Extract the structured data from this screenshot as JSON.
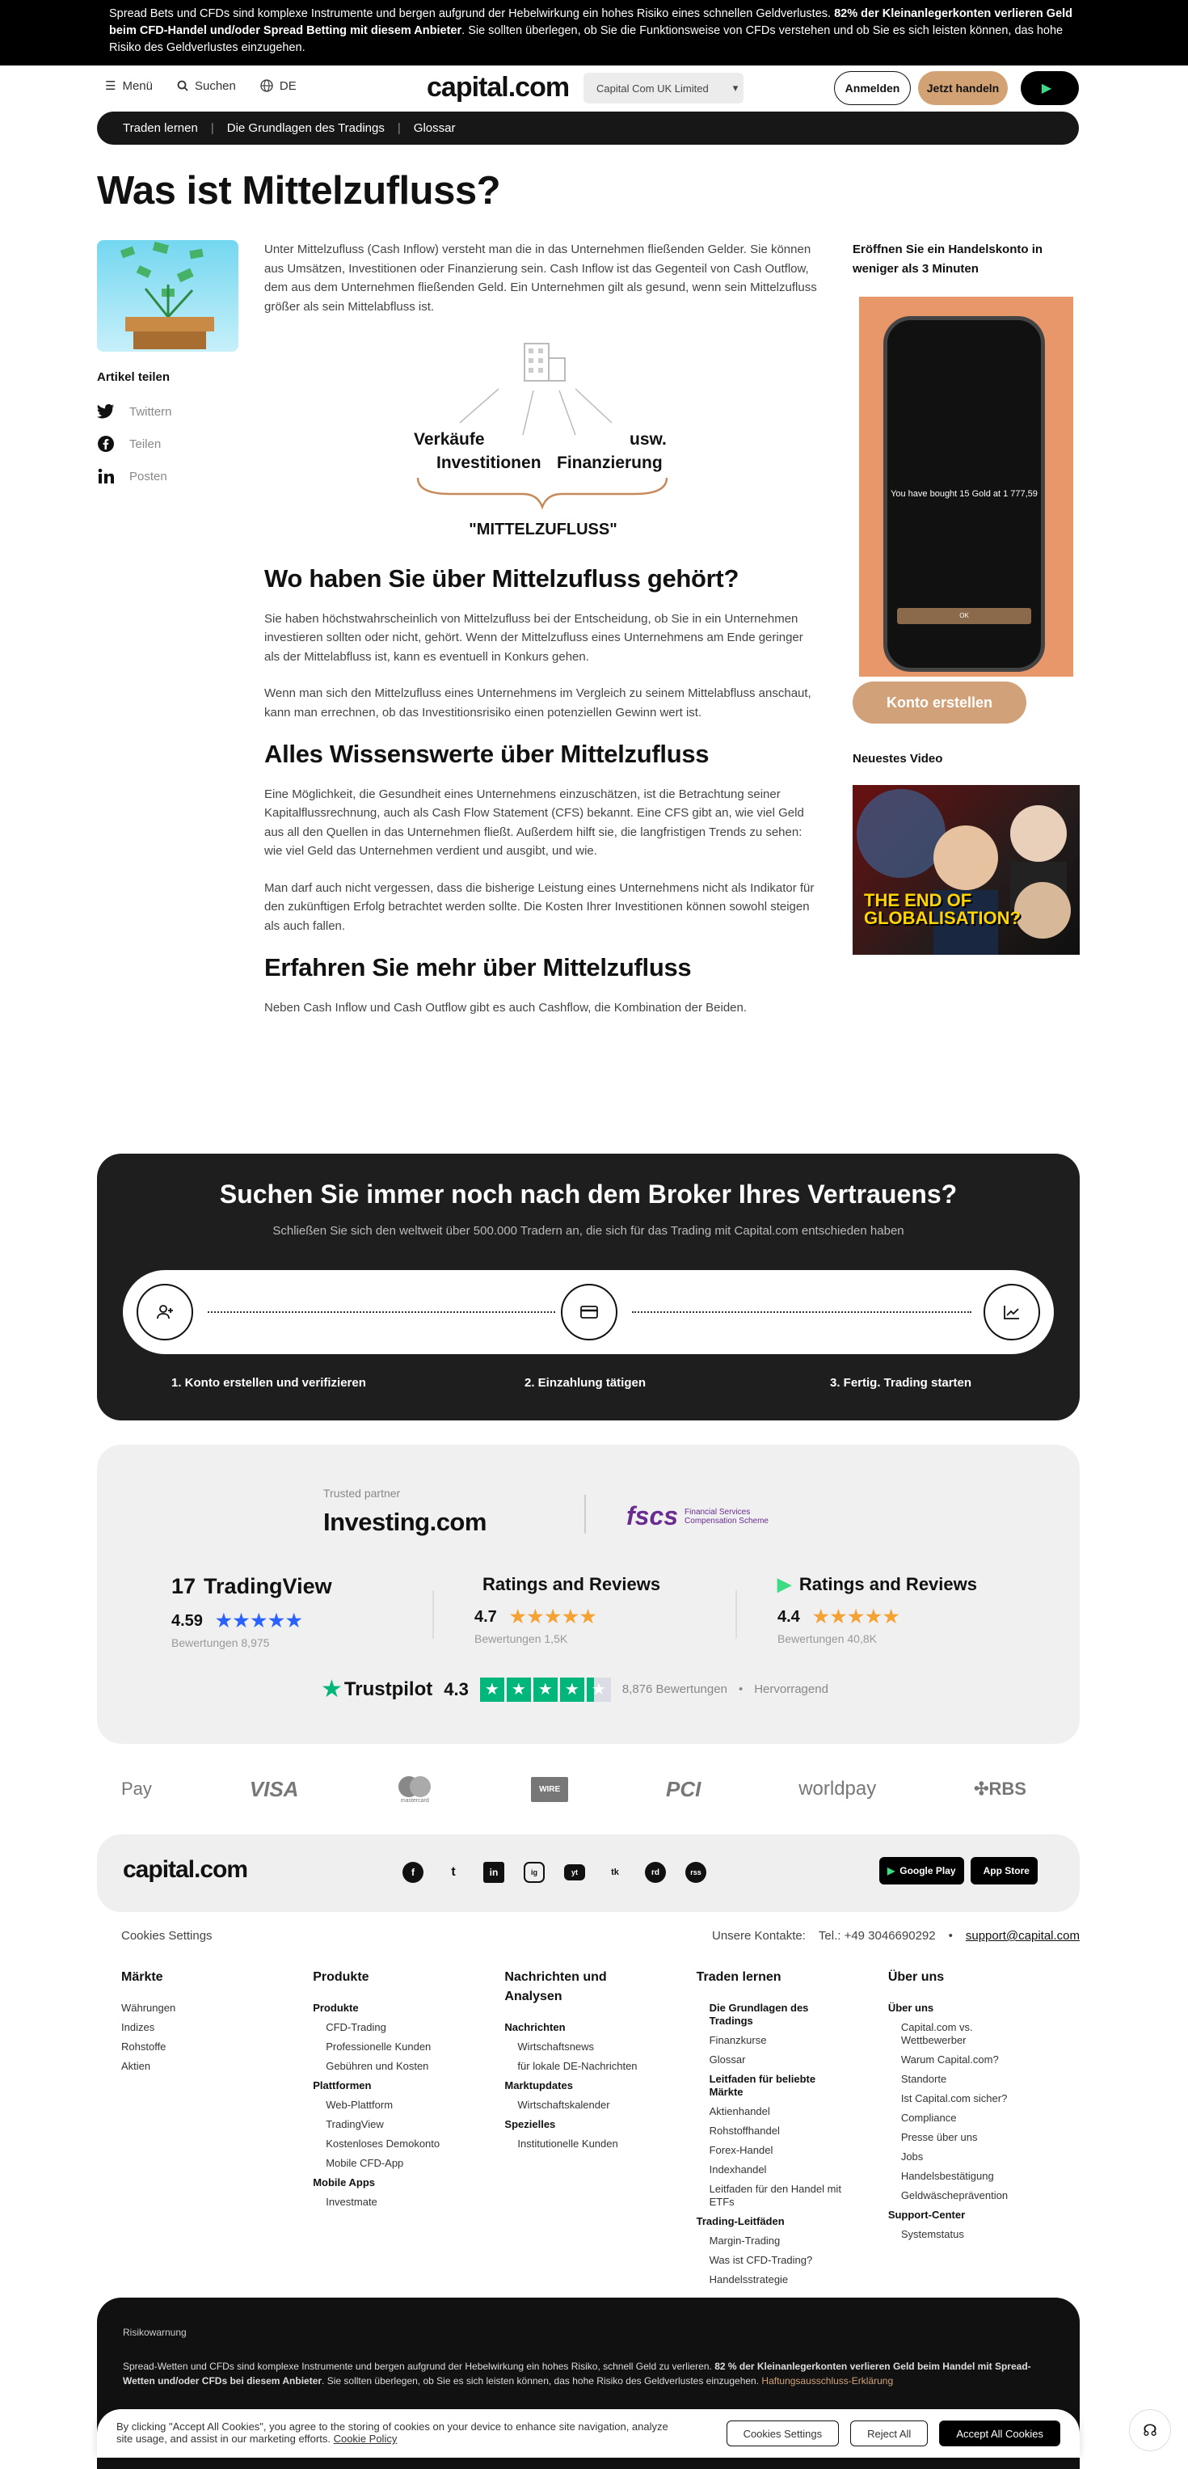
{
  "banner": {
    "text_1": "Spread Bets und CFDs sind komplexe Instrumente und bergen aufgrund der Hebelwirkung ein hohes Risiko eines schnellen Geldverlustes.",
    "bold": "82% der Kleinanlegerkonten verlieren Geld beim CFD-Handel und/oder Spread Betting mit diesem Anbieter",
    "text_2": ". Sie sollten überlegen, ob Sie die Funktionsweise von CFDs verstehen und ob Sie es sich leisten können, das hohe Risiko des Geldverlustes einzugehen."
  },
  "header": {
    "menu": "Menü",
    "search": "Suchen",
    "lang": "DE",
    "logo": "capital.com",
    "entity": "Capital Com UK Limited",
    "login": "Anmelden",
    "trade": "Jetzt handeln"
  },
  "breadcrumb": [
    "Traden lernen",
    "Die Grundlagen des Tradings",
    "Glossar"
  ],
  "page_title": "Was ist Mittelzufluss?",
  "share": {
    "title": "Artikel teilen",
    "items": [
      "Twittern",
      "Teilen",
      "Posten"
    ]
  },
  "article": {
    "intro": "Unter Mittelzufluss (Cash Inflow) versteht man die in das Unternehmen fließenden Gelder. Sie können aus Umsätzen, Investitionen oder Finanzierung sein. Cash Inflow ist das Gegenteil von Cash Outflow, dem aus dem Unternehmen fließenden Geld. Ein Unternehmen gilt als gesund, wenn sein Mittelzufluss größer als sein Mittelabfluss ist.",
    "diagram": {
      "sales": "Verkäufe",
      "investments": "Investitionen",
      "financing": "Finanzierung",
      "etc": "usw.",
      "label": "\"MITTELZUFLUSS\""
    },
    "h2_1": "Wo haben Sie über Mittelzufluss gehört?",
    "p1": "Sie haben höchstwahrscheinlich von Mittelzufluss bei der Entscheidung, ob Sie in ein Unternehmen investieren sollten oder nicht, gehört. Wenn der Mittelzufluss eines Unternehmens am Ende geringer als der Mittelabfluss ist, kann es eventuell in Konkurs gehen.",
    "p2": "Wenn man sich den Mittelzufluss eines Unternehmens im Vergleich zu seinem Mittelabfluss anschaut, kann man errechnen, ob das Investitionsrisiko einen potenziellen Gewinn wert ist.",
    "h2_2": "Alles Wissenswerte über Mittelzufluss",
    "p3": "Eine Möglichkeit, die Gesundheit eines Unternehmens einzuschätzen, ist die Betrachtung seiner Kapitalflussrechnung, auch als Cash Flow Statement (CFS) bekannt. Eine CFS gibt an, wie viel Geld aus all den Quellen in das Unternehmen fließt. Außerdem hilft sie, die langfristigen Trends zu sehen: wie viel Geld das Unternehmen verdient und ausgibt, und wie.",
    "p4": "Man darf auch nicht vergessen, dass die bisherige Leistung eines Unternehmens nicht als Indikator für den zukünftigen Erfolg betrachtet werden sollte. Die Kosten Ihrer Investitionen können sowohl steigen als auch fallen.",
    "h2_3": "Erfahren Sie mehr über Mittelzufluss",
    "p5": "Neben Cash Inflow und Cash Outflow gibt es auch Cashflow, die Kombination der Beiden."
  },
  "sidebar": {
    "title": "Eröffnen Sie ein Handelskonto in weniger als 3 Minuten",
    "phone_msg": "You have bought 15 Gold at 1 777,59",
    "phone_ok": "OK",
    "button": "Konto erstellen",
    "video_title": "Neuestes Video",
    "video_text": "THE END OF GLOBALISATION?"
  },
  "cta": {
    "title": "Suchen Sie immer noch nach dem Broker Ihres Vertrauens?",
    "subtitle": "Schließen Sie sich den weltweit über 500.000 Tradern an, die sich für das Trading mit Capital.com entschieden haben",
    "steps": [
      "1. Konto erstellen und verifizieren",
      "2. Einzahlung tätigen",
      "3. Fertig. Trading starten"
    ]
  },
  "trust": {
    "trusted_partner": "Trusted partner",
    "investing": "Investing.com",
    "fscs": "fscs",
    "fscs_sub": "Financial Services Compensation Scheme",
    "ratings": [
      {
        "brand": "TradingView",
        "score": "4.59",
        "stars": 4.59,
        "count": "Bewertungen 8,975"
      },
      {
        "brand": "Ratings and Reviews",
        "score": "4.7",
        "stars": 4.7,
        "count": "Bewertungen 1,5K"
      },
      {
        "brand": "Ratings and Reviews",
        "score": "4.4",
        "stars": 4.4,
        "count": "Bewertungen 40,8K"
      }
    ],
    "trustpilot": "Trustpilot",
    "tp_score": "4.3",
    "tp_count": "8,876 Bewertungen",
    "tp_label": "Hervorragend"
  },
  "payments": [
    "Pay",
    "VISA",
    "mastercard",
    "WIRE",
    "PCI",
    "worldpay",
    "RBS"
  ],
  "footer": {
    "logo": "capital.com",
    "socials": [
      "f",
      "t",
      "in",
      "ig",
      "yt",
      "tk",
      "rd",
      "rss"
    ],
    "stores": [
      "Google Play",
      "App Store"
    ],
    "cookies": "Cookies Settings",
    "contacts_label": "Unsere Kontakte:",
    "phone": "Tel.: +49 3046690292",
    "email": "support@capital.com",
    "cols": [
      {
        "title": "Märkte",
        "items": [
          {
            "t": "Währungen",
            "g": 0,
            "i": 0
          },
          {
            "t": "Indizes",
            "g": 0,
            "i": 0
          },
          {
            "t": "Rohstoffe",
            "g": 0,
            "i": 0
          },
          {
            "t": "Aktien",
            "g": 0,
            "i": 0
          }
        ]
      },
      {
        "title": "Produkte",
        "items": [
          {
            "t": "Produkte",
            "g": 1,
            "i": 0
          },
          {
            "t": "CFD-Trading",
            "g": 0,
            "i": 1
          },
          {
            "t": "Professionelle Kunden",
            "g": 0,
            "i": 1
          },
          {
            "t": "Gebühren und Kosten",
            "g": 0,
            "i": 1
          },
          {
            "t": "Plattformen",
            "g": 1,
            "i": 0
          },
          {
            "t": "Web-Plattform",
            "g": 0,
            "i": 1
          },
          {
            "t": "TradingView",
            "g": 0,
            "i": 1
          },
          {
            "t": "Kostenloses Demokonto",
            "g": 0,
            "i": 1
          },
          {
            "t": "Mobile CFD-App",
            "g": 0,
            "i": 1
          },
          {
            "t": "Mobile Apps",
            "g": 1,
            "i": 0
          },
          {
            "t": "Investmate",
            "g": 0,
            "i": 1
          }
        ]
      },
      {
        "title": "Nachrichten und Analysen",
        "items": [
          {
            "t": "Nachrichten",
            "g": 1,
            "i": 0
          },
          {
            "t": "Wirtschaftsnews",
            "g": 0,
            "i": 1
          },
          {
            "t": "für lokale DE-Nachrichten",
            "g": 0,
            "i": 1
          },
          {
            "t": "Marktupdates",
            "g": 1,
            "i": 0
          },
          {
            "t": "Wirtschaftskalender",
            "g": 0,
            "i": 1
          },
          {
            "t": "Spezielles",
            "g": 1,
            "i": 0
          },
          {
            "t": "Institutionelle Kunden",
            "g": 0,
            "i": 1
          }
        ]
      },
      {
        "title": "Traden lernen",
        "items": [
          {
            "t": "Die Grundlagen des Tradings",
            "g": 1,
            "i": 0
          },
          {
            "t": "Finanzkurse",
            "g": 0,
            "i": 1
          },
          {
            "t": "Glossar",
            "g": 0,
            "i": 1
          },
          {
            "t": "Leitfaden für beliebte Märkte",
            "g": 1,
            "i": 0
          },
          {
            "t": "Aktienhandel",
            "g": 0,
            "i": 1
          },
          {
            "t": "Rohstoffhandel",
            "g": 0,
            "i": 1
          },
          {
            "t": "Forex-Handel",
            "g": 0,
            "i": 1
          },
          {
            "t": "Indexhandel",
            "g": 0,
            "i": 1
          },
          {
            "t": "Leitfaden für den Handel mit ETFs",
            "g": 0,
            "i": 1
          },
          {
            "t": "Trading-Leitfäden",
            "g": 1,
            "i": 0
          },
          {
            "t": "Margin-Trading",
            "g": 0,
            "i": 1
          },
          {
            "t": "Was ist CFD-Trading?",
            "g": 0,
            "i": 1
          },
          {
            "t": "Handelsstrategie",
            "g": 0,
            "i": 1
          }
        ]
      },
      {
        "title": "Über uns",
        "items": [
          {
            "t": "Über uns",
            "g": 1,
            "i": 0
          },
          {
            "t": "Capital.com vs. Wettbewerber",
            "g": 0,
            "i": 1
          },
          {
            "t": "Warum Capital.com?",
            "g": 0,
            "i": 1
          },
          {
            "t": "Standorte",
            "g": 0,
            "i": 1
          },
          {
            "t": "Ist Capital.com sicher?",
            "g": 0,
            "i": 1
          },
          {
            "t": "Compliance",
            "g": 0,
            "i": 1
          },
          {
            "t": "Presse über uns",
            "g": 0,
            "i": 1
          },
          {
            "t": "Jobs",
            "g": 0,
            "i": 1
          },
          {
            "t": "Handelsbestätigung",
            "g": 0,
            "i": 1
          },
          {
            "t": "Geldwäscheprävention",
            "g": 0,
            "i": 1
          },
          {
            "t": "Support-Center",
            "g": 1,
            "i": 0
          },
          {
            "t": "Systemstatus",
            "g": 0,
            "i": 1
          }
        ]
      }
    ]
  },
  "risk": {
    "title": "Risikowarnung",
    "text_1": "Spread-Wetten und CFDs sind komplexe Instrumente und bergen aufgrund der Hebelwirkung ein hohes Risiko, schnell Geld zu verlieren.",
    "bold": "82 % der Kleinanlegerkonten verlieren Geld beim Handel mit Spread-Wetten und/oder CFDs bei diesem Anbieter",
    "text_2": ". Sie sollten überlegen, ob Sie es sich leisten können, das hohe Risiko des Geldverlustes einzugehen.",
    "link": "Haftungsausschluss-Erklärung"
  },
  "cookie": {
    "text": "By clicking \"Accept All Cookies\", you agree to the storing of cookies on your device to enhance site navigation, analyze site usage, and assist in our marketing efforts.",
    "policy": "Cookie Policy",
    "settings": "Cookies Settings",
    "reject": "Reject All",
    "accept": "Accept All Cookies"
  },
  "colors": {
    "accent": "#d2a274",
    "dark": "#1e1e1e",
    "trustpilot": "#00b67a",
    "star": "#f3a233",
    "rating_blue": "#2962ff"
  }
}
